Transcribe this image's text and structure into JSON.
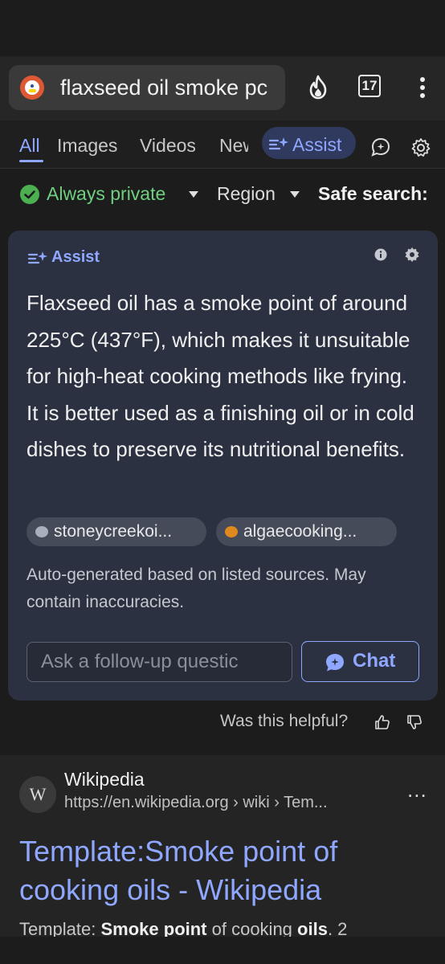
{
  "browser": {
    "address_text": "flaxseed oil smoke pc",
    "tab_count": "17"
  },
  "nav": {
    "all": "All",
    "images": "Images",
    "videos": "Videos",
    "news": "News",
    "assist": "Assist"
  },
  "filters": {
    "private": "Always private",
    "region": "Region",
    "safe_search": "Safe search:"
  },
  "assist_card": {
    "header": "Assist",
    "answer": "Flaxseed oil has a smoke point of around 225°C (437°F), which makes it unsuitable for high-heat cooking methods like frying. It is better used as a finishing oil or in cold dishes to preserve its nutritional benefits.",
    "sources": [
      {
        "label": "stoneycreekoi...",
        "color": "#a9b0bd"
      },
      {
        "label": "algaecooking...",
        "color": "#e08a1e"
      }
    ],
    "disclaimer": "Auto-generated based on listed sources. May contain inaccuracies.",
    "followup_placeholder": "Ask a follow-up questic",
    "chat_label": "Chat"
  },
  "feedback": {
    "question": "Was this helpful?"
  },
  "result": {
    "avatar_letter": "W",
    "site": "Wikipedia",
    "url": "https://en.wikipedia.org › wiki › Tem...",
    "more": "...",
    "title": "Template:Smoke point of cooking oils - Wikipedia",
    "snippet_1": "Template: ",
    "snippet_2": "Smoke point",
    "snippet_3": " of cooking ",
    "snippet_4": "oils",
    "snippet_5": ". 2"
  },
  "colors": {
    "accent": "#8fa7ff",
    "private_green": "#6fcf7f",
    "ddg_orange": "#de5833"
  }
}
